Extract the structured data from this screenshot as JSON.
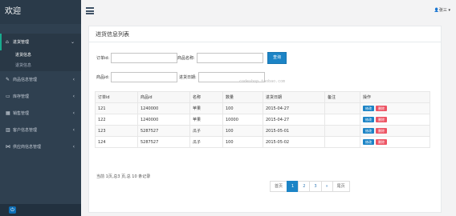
{
  "sidebar": {
    "brand": "欢迎",
    "items": [
      {
        "label": "进货管理",
        "icon": "home-icon",
        "glyph": "⌂",
        "expanded": true
      },
      {
        "label": "商品信息管理",
        "icon": "edit-icon",
        "glyph": "✎"
      },
      {
        "label": "库存管理",
        "icon": "monitor-icon",
        "glyph": "▭"
      },
      {
        "label": "销售管理",
        "icon": "grid-icon",
        "glyph": "▦"
      },
      {
        "label": "客户信息管理",
        "icon": "bar-chart-icon",
        "glyph": "▥"
      },
      {
        "label": "供应商信息管理",
        "icon": "share-icon",
        "glyph": "⋈"
      }
    ],
    "sub_items": [
      "进货信息",
      "退货信息"
    ],
    "footer_icon": "power-icon"
  },
  "topbar": {
    "menu_icon": "hamburger-icon",
    "user_icon": "user-icon",
    "user_name": "张三"
  },
  "panel": {
    "title": "进货信息列表"
  },
  "search": {
    "order_id_label": "订单id:",
    "product_name_label": "商品名称:",
    "product_id_label": "商品id:",
    "purchase_date_label": "进货日期:",
    "button_label": "查询",
    "order_id_value": "",
    "product_name_value": "",
    "product_id_value": "",
    "purchase_date_value": ""
  },
  "watermark": "codeshop.taobao.com",
  "table": {
    "headers": [
      "订单id",
      "商品id",
      "名称",
      "数量",
      "进货日期",
      "备注",
      "操作"
    ],
    "rows": [
      [
        "121",
        "1240000",
        "苹果",
        "100",
        "2015-04-27",
        ""
      ],
      [
        "122",
        "1240000",
        "苹果",
        "10000",
        "2015-04-27",
        ""
      ],
      [
        "123",
        "5287527",
        "瓜子",
        "100",
        "2015-05-01",
        ""
      ],
      [
        "124",
        "5287527",
        "瓜子",
        "100",
        "2015-05-02",
        ""
      ]
    ],
    "edit_label": "修改",
    "delete_label": "删除"
  },
  "summary": "当前 1页,总3 页,总 10 条记录",
  "pagination": {
    "first": "首页",
    "pages": [
      "1",
      "2",
      "3"
    ],
    "next": "»",
    "last": "尾页",
    "current": "1"
  },
  "colors": {
    "sidebar": "#2f4050",
    "accent": "#1c84c6",
    "danger": "#ed5565",
    "active_border": "#19aa8d"
  }
}
